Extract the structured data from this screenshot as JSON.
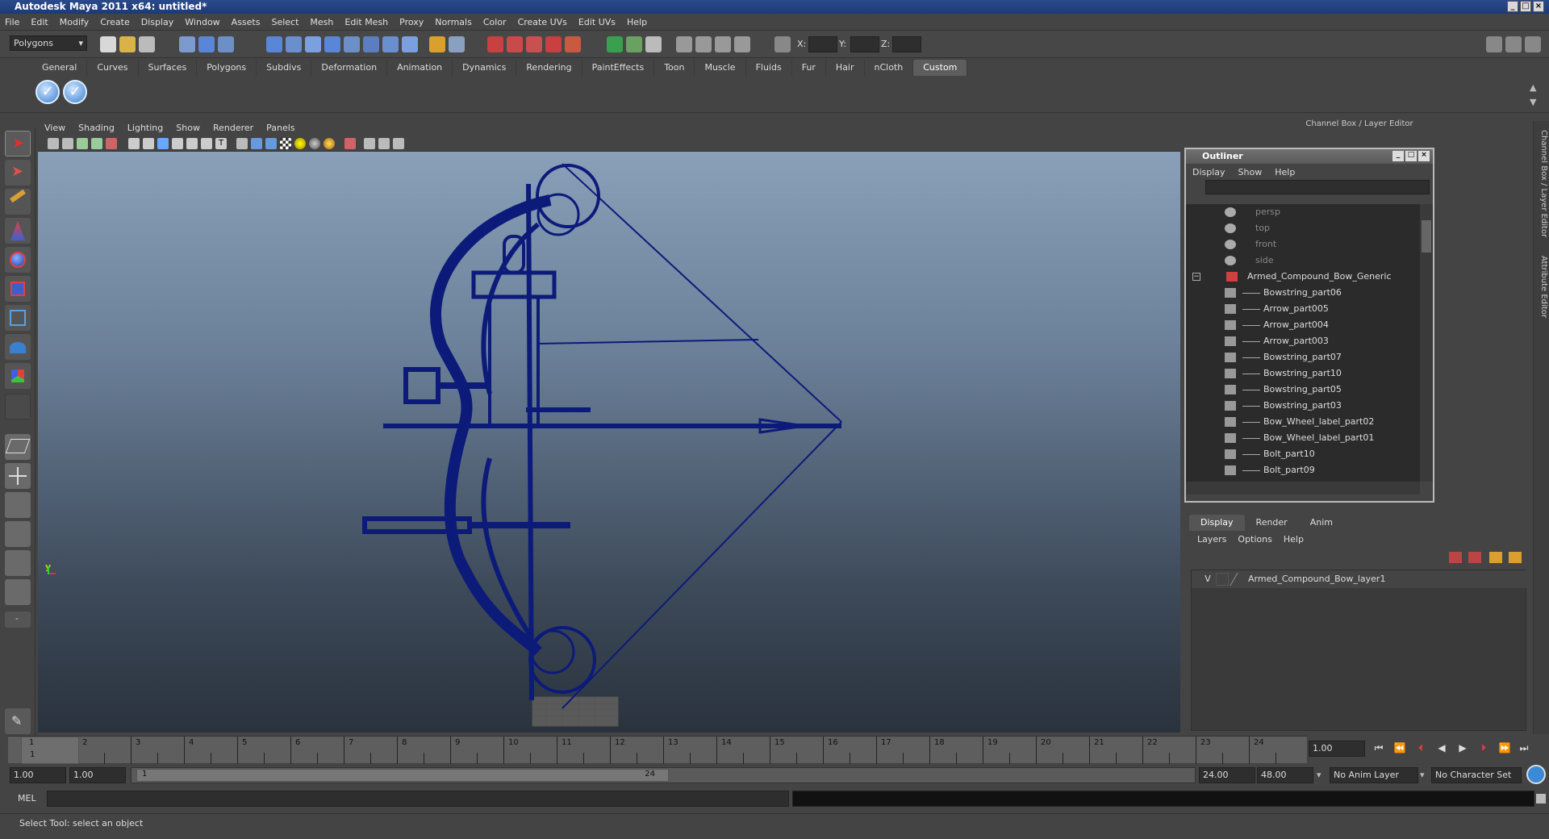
{
  "window": {
    "title": "Autodesk Maya 2011 x64: untitled*"
  },
  "menu": [
    "File",
    "Edit",
    "Modify",
    "Create",
    "Display",
    "Window",
    "Assets",
    "Select",
    "Mesh",
    "Edit Mesh",
    "Proxy",
    "Normals",
    "Color",
    "Create UVs",
    "Edit UVs",
    "Help"
  ],
  "status": {
    "mode": "Polygons",
    "x_label": "X:",
    "y_label": "Y:",
    "z_label": "Z:"
  },
  "shelf_tabs": [
    "General",
    "Curves",
    "Surfaces",
    "Polygons",
    "Subdivs",
    "Deformation",
    "Animation",
    "Dynamics",
    "Rendering",
    "PaintEffects",
    "Toon",
    "Muscle",
    "Fluids",
    "Fur",
    "Hair",
    "nCloth",
    "Custom"
  ],
  "shelf_active": "Custom",
  "viewport": {
    "menu": [
      "View",
      "Shading",
      "Lighting",
      "Show",
      "Renderer",
      "Panels"
    ],
    "axis_label": "y"
  },
  "channel_box_title": "Channel Box / Layer Editor",
  "side_tabs": [
    "Channel Box / Layer Editor",
    "Attribute Editor"
  ],
  "outliner": {
    "title": "Outliner",
    "menu": [
      "Display",
      "Show",
      "Help"
    ],
    "cameras": [
      "persp",
      "top",
      "front",
      "side"
    ],
    "group": "Armed_Compound_Bow_Generic",
    "children": [
      "Bowstring_part06",
      "Arrow_part005",
      "Arrow_part004",
      "Arrow_part003",
      "Bowstring_part07",
      "Bowstring_part10",
      "Bowstring_part05",
      "Bowstring_part03",
      "Bow_Wheel_label_part02",
      "Bow_Wheel_label_part01",
      "Bolt_part10",
      "Bolt_part09"
    ]
  },
  "layer_editor": {
    "tabs": [
      "Display",
      "Render",
      "Anim"
    ],
    "menu": [
      "Layers",
      "Options",
      "Help"
    ],
    "visible_flag": "V",
    "layer_name": "Armed_Compound_Bow_layer1"
  },
  "timeline": {
    "ticks": [
      "1",
      "2",
      "3",
      "4",
      "5",
      "6",
      "7",
      "8",
      "9",
      "10",
      "11",
      "12",
      "13",
      "14",
      "15",
      "16",
      "17",
      "18",
      "19",
      "20",
      "21",
      "22",
      "23",
      "24"
    ],
    "current_frame_marker": "1",
    "current_time": "1.00"
  },
  "range": {
    "start_time": "1.00",
    "playback_start": "1.00",
    "slider_start": "1",
    "slider_end": "24",
    "playback_end": "24.00",
    "end_time": "48.00",
    "anim_layer": "No Anim Layer",
    "character_set": "No Character Set"
  },
  "command_line": {
    "label": "MEL"
  },
  "help_line": "Select Tool: select an object",
  "colors": {
    "wireframe": "#0c1a7a",
    "viewport_top": "#8aa0b8",
    "viewport_bottom": "#2a323d"
  }
}
